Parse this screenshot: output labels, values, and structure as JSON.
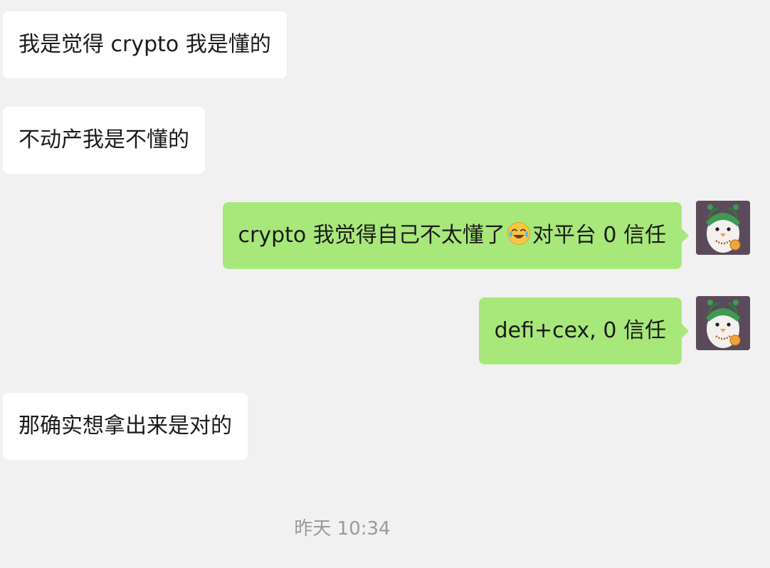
{
  "messages": [
    {
      "direction": "incoming",
      "text": "我是觉得 crypto 我是懂的"
    },
    {
      "direction": "incoming",
      "text": "不动产我是不懂的"
    },
    {
      "direction": "outgoing",
      "text_before_emoji": "crypto 我觉得自己不太懂了",
      "emoji": "crying-laughing-face",
      "text_after_emoji": "对平台 0 信任"
    },
    {
      "direction": "outgoing",
      "text": "defi+cex, 0 信任"
    },
    {
      "direction": "incoming",
      "text": "那确实想拿出来是对的"
    }
  ],
  "timestamp": "昨天 10:34",
  "colors": {
    "background": "#f1f1f1",
    "incoming_bubble": "#ffffff",
    "outgoing_bubble": "#a8e87a",
    "timestamp_text": "#9a9a9a"
  },
  "avatar_icon": "penguin-avatar-icon"
}
